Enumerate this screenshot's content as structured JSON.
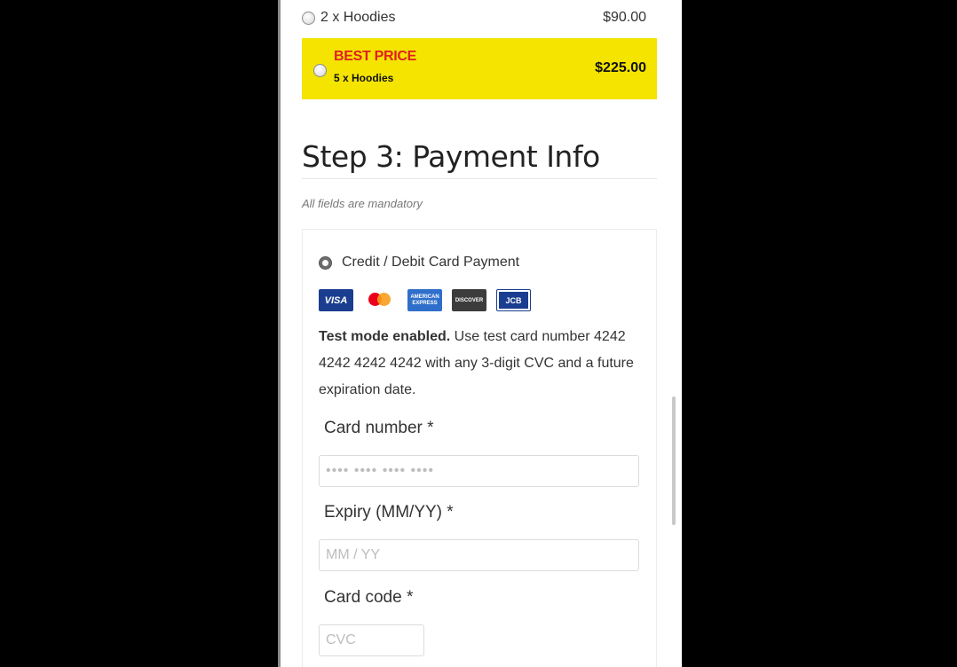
{
  "offers": [
    {
      "label": "2 x Hoodies",
      "price": "$90.00"
    },
    {
      "tag": "BEST PRICE",
      "label": "5 x Hoodies",
      "price": "$225.00"
    }
  ],
  "step": {
    "title": "Step 3: Payment Info",
    "note": "All fields are mandatory"
  },
  "payment": {
    "method_label": "Credit / Debit Card Payment",
    "cards": [
      "VISA",
      "mastercard",
      "AMERICAN EXPRESS",
      "DISCOVER",
      "JCB"
    ],
    "notice_bold": "Test mode enabled.",
    "notice_text": " Use test card number 4242 4242 4242 4242 with any 3-digit CVC and a future expiration date.",
    "card_number_label": "Card number *",
    "card_number_placeholder": "•••• •••• •••• ••••",
    "expiry_label": "Expiry (MM/YY) *",
    "expiry_placeholder": "MM / YY",
    "cvc_label": "Card code *",
    "cvc_placeholder": "CVC"
  }
}
